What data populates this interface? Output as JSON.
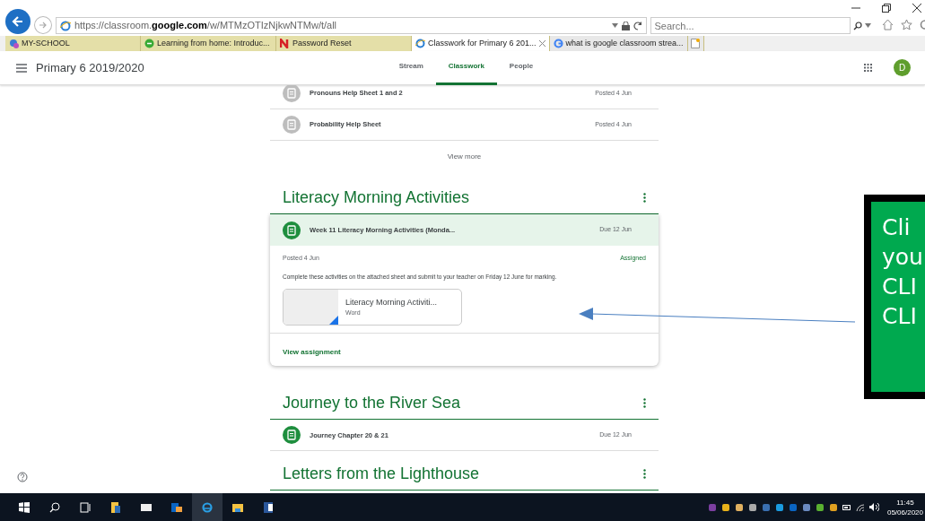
{
  "browser": {
    "url": "https://classroom.**google.com**/w/MTMzOTIzNjkwNTMw/t/all",
    "search_placeholder": "Search...",
    "tabs": [
      {
        "title": "MY-SCHOOL",
        "selected": false,
        "pinned": true
      },
      {
        "title": "Learning from home: Introduc...",
        "selected": false,
        "pinned": true
      },
      {
        "title": "Password Reset",
        "selected": false,
        "pinned": true
      },
      {
        "title": "Classwork for Primary 6 201...",
        "selected": true,
        "pinned": false
      },
      {
        "title": "what is google classroom strea...",
        "selected": false,
        "pinned": false
      }
    ]
  },
  "app": {
    "course_title": "Primary 6 2019/2020",
    "nav": [
      {
        "label": "Stream",
        "selected": false
      },
      {
        "label": "Classwork",
        "selected": true
      },
      {
        "label": "People",
        "selected": false
      }
    ],
    "avatar": "D"
  },
  "earlier_items": [
    {
      "title": "Pronouns Help Sheet 1 and 2",
      "date": "Posted 4 Jun"
    },
    {
      "title": "Probability Help Sheet",
      "date": "Posted 4 Jun"
    }
  ],
  "view_more": "View more",
  "topics": [
    {
      "title": "Literacy Morning Activities",
      "items": [
        {
          "title": "Week 11 Literacy Morning Activities (Monda...",
          "date": "Due 12 Jun",
          "expanded": true,
          "posted": "Posted 4 Jun",
          "status": "Assigned",
          "description": "Complete these activities on the attached sheet and submit to your teacher on Friday 12 June for marking.",
          "attachment": {
            "name": "Literacy Morning Activiti...",
            "type": "Word"
          },
          "link": "View assignment"
        }
      ]
    },
    {
      "title": "Journey to the River Sea",
      "items": [
        {
          "title": "Journey Chapter 20 & 21",
          "date": "Due 12 Jun",
          "expanded": false
        }
      ]
    },
    {
      "title": "Letters from the Lighthouse"
    }
  ],
  "callout": [
    "Cli",
    "you",
    "CLI",
    "CLI"
  ],
  "taskbar": {
    "time": "11:45",
    "date": "05/06/2020"
  }
}
